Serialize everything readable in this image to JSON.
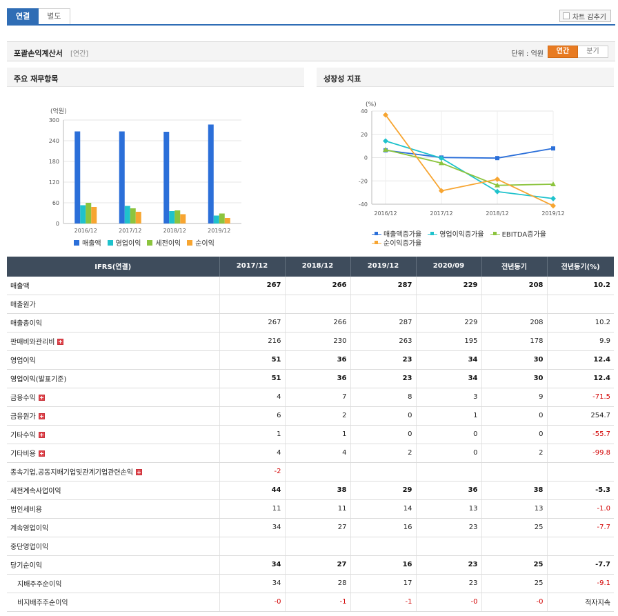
{
  "tabs": {
    "consolidated": "연결",
    "separate": "별도"
  },
  "hide_chart": "차트 감추기",
  "section": {
    "title": "포괄손익계산서",
    "subtitle": "[연간]",
    "unit": "단위 : 억원",
    "annual": "연간",
    "quarterly": "분기"
  },
  "colors": {
    "tab_blue": "#2f6db5",
    "accent_orange": "#e87b22",
    "header_dark": "#3e4c5c",
    "negative_red": "#d20000"
  },
  "charts": {
    "major": {
      "title": "주요 재무항목"
    },
    "growth": {
      "title": "성장성 지표"
    }
  },
  "chart_data": [
    {
      "type": "bar",
      "title": "주요 재무항목",
      "ylabel": "(억원)",
      "ylim": [
        0,
        300
      ],
      "yticks": [
        "0",
        "60",
        "120",
        "180",
        "240",
        "300"
      ],
      "categories": [
        "2016/12",
        "2017/12",
        "2018/12",
        "2019/12"
      ],
      "series": [
        {
          "name": "매출액",
          "color": "#2b6fd9",
          "values": [
            267,
            267,
            266,
            287
          ]
        },
        {
          "name": "영업이익",
          "color": "#1fc2cc",
          "values": [
            53,
            51,
            36,
            23
          ]
        },
        {
          "name": "세전이익",
          "color": "#8cc43e",
          "values": [
            60,
            44,
            38,
            29
          ]
        },
        {
          "name": "순이익",
          "color": "#f7a531",
          "values": [
            48,
            34,
            27,
            16
          ]
        }
      ],
      "legend": "bottom",
      "grid": true
    },
    {
      "type": "line",
      "title": "성장성 지표",
      "ylabel": "(%)",
      "ylim": [
        -40,
        40
      ],
      "yticks": [
        "-40",
        "-20",
        "0",
        "20",
        "40"
      ],
      "categories": [
        "2016/12",
        "2017/12",
        "2018/12",
        "2019/12"
      ],
      "series": [
        {
          "name": "매출액증가율",
          "color": "#2b6fd9",
          "marker": "square",
          "values": [
            6.3,
            0.1,
            -0.4,
            7.9
          ]
        },
        {
          "name": "영업이익증가율",
          "color": "#1fc2cc",
          "marker": "diamond",
          "values": [
            14.3,
            -0.5,
            -29.2,
            -35.2
          ]
        },
        {
          "name": "EBITDA증가율",
          "color": "#8cc43e",
          "marker": "triangle",
          "values": [
            6.8,
            -4.7,
            -23.8,
            -22.8
          ]
        },
        {
          "name": "순이익증가율",
          "color": "#f7a531",
          "marker": "diamond",
          "values": [
            36.7,
            -28.5,
            -18.6,
            -41.4
          ]
        }
      ],
      "legend": "bottom",
      "grid": true
    }
  ],
  "table": {
    "headers": [
      "IFRS(연결)",
      "2017/12",
      "2018/12",
      "2019/12",
      "2020/09",
      "전년동기",
      "전년동기(%)"
    ],
    "rows": [
      {
        "label": "매출액",
        "bold": true,
        "values": [
          "267",
          "266",
          "287",
          "229",
          "208",
          "10.2"
        ]
      },
      {
        "label": "매출원가",
        "values": [
          "",
          "",
          "",
          "",
          "",
          ""
        ]
      },
      {
        "label": "매출총이익",
        "values": [
          "267",
          "266",
          "287",
          "229",
          "208",
          "10.2"
        ]
      },
      {
        "label": "판매비와관리비",
        "expand": true,
        "values": [
          "216",
          "230",
          "263",
          "195",
          "178",
          "9.9"
        ]
      },
      {
        "label": "영업이익",
        "bold": true,
        "values": [
          "51",
          "36",
          "23",
          "34",
          "30",
          "12.4"
        ]
      },
      {
        "label": "영업이익(발표기준)",
        "bold": true,
        "values": [
          "51",
          "36",
          "23",
          "34",
          "30",
          "12.4"
        ]
      },
      {
        "label": "금융수익",
        "expand": true,
        "values": [
          "4",
          "7",
          "8",
          "3",
          "9",
          "-71.5"
        ]
      },
      {
        "label": "금융원가",
        "expand": true,
        "values": [
          "6",
          "2",
          "0",
          "1",
          "0",
          "254.7"
        ]
      },
      {
        "label": "기타수익",
        "expand": true,
        "values": [
          "1",
          "1",
          "0",
          "0",
          "0",
          "-55.7"
        ]
      },
      {
        "label": "기타비용",
        "expand": true,
        "values": [
          "4",
          "4",
          "2",
          "0",
          "2",
          "-99.8"
        ]
      },
      {
        "label": "종속기업,공동지배기업및관계기업관련손익",
        "expand": true,
        "values": [
          "-2",
          "",
          "",
          "",
          "",
          ""
        ]
      },
      {
        "label": "세전계속사업이익",
        "bold": true,
        "values": [
          "44",
          "38",
          "29",
          "36",
          "38",
          "-5.3"
        ]
      },
      {
        "label": "법인세비용",
        "values": [
          "11",
          "11",
          "14",
          "13",
          "13",
          "-1.0"
        ]
      },
      {
        "label": "계속영업이익",
        "values": [
          "34",
          "27",
          "16",
          "23",
          "25",
          "-7.7"
        ]
      },
      {
        "label": "중단영업이익",
        "values": [
          "",
          "",
          "",
          "",
          "",
          ""
        ]
      },
      {
        "label": "당기순이익",
        "bold": true,
        "values": [
          "34",
          "27",
          "16",
          "23",
          "25",
          "-7.7"
        ]
      },
      {
        "label": "지배주주순이익",
        "sub": true,
        "values": [
          "34",
          "28",
          "17",
          "23",
          "25",
          "-9.1"
        ]
      },
      {
        "label": "비지배주주순이익",
        "sub": true,
        "values": [
          "-0",
          "-1",
          "-1",
          "-0",
          "-0",
          "적자지속"
        ]
      }
    ]
  }
}
